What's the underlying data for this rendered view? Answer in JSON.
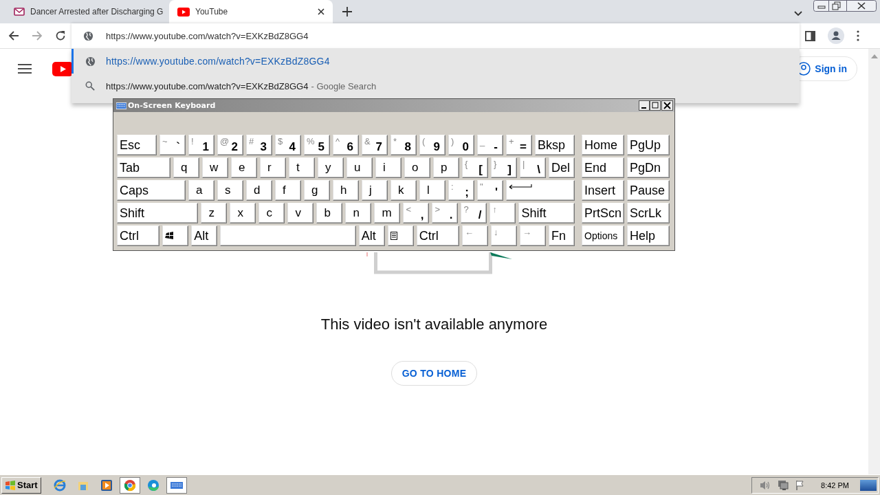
{
  "browser": {
    "tabs": [
      {
        "kind": "news",
        "title": "Dancer Arrested after Discharging G",
        "selected": false
      },
      {
        "kind": "youtube",
        "title": "YouTube",
        "selected": true
      }
    ],
    "omnibox": {
      "value": "https://www.youtube.com/watch?v=EXKzBdZ8GG4",
      "expanded": true
    },
    "suggestions": [
      {
        "kind": "url",
        "text": "https://www.youtube.com/watch?v=EXKzBdZ8GG4",
        "selected": true
      },
      {
        "kind": "search",
        "text": "https://www.youtube.com/watch?v=EXKzBdZ8GG4",
        "suffix": "- Google Search",
        "selected": false
      }
    ]
  },
  "page": {
    "sign_in": "Sign in",
    "message": "This video isn't available anymore",
    "home_button": "GO TO HOME"
  },
  "keyboard": {
    "title": "On-Screen Keyboard",
    "main_rows": [
      [
        {
          "kind": "wide",
          "label": "Esc"
        },
        {
          "kind": "key",
          "shift": "~",
          "label": "`"
        },
        {
          "kind": "key",
          "shift": "!",
          "label": "1"
        },
        {
          "kind": "key",
          "shift": "@",
          "label": "2"
        },
        {
          "kind": "key",
          "shift": "#",
          "label": "3"
        },
        {
          "kind": "key",
          "shift": "$",
          "label": "4"
        },
        {
          "kind": "key",
          "shift": "%",
          "label": "5"
        },
        {
          "kind": "key",
          "shift": "^",
          "label": "6"
        },
        {
          "kind": "key",
          "shift": "&",
          "label": "7"
        },
        {
          "kind": "key",
          "shift": "*",
          "label": "8"
        },
        {
          "kind": "key",
          "shift": "(",
          "label": "9"
        },
        {
          "kind": "key",
          "shift": ")",
          "label": "0"
        },
        {
          "kind": "key",
          "shift": "_",
          "label": "-"
        },
        {
          "kind": "key",
          "shift": "+",
          "label": "="
        },
        {
          "kind": "wide",
          "label": "Bksp"
        }
      ],
      [
        {
          "kind": "wide",
          "label": "Tab"
        },
        {
          "kind": "key",
          "label": "q"
        },
        {
          "kind": "key",
          "label": "w"
        },
        {
          "kind": "key",
          "label": "e"
        },
        {
          "kind": "key",
          "label": "r"
        },
        {
          "kind": "key",
          "label": "t"
        },
        {
          "kind": "key",
          "label": "y"
        },
        {
          "kind": "key",
          "label": "u"
        },
        {
          "kind": "key",
          "label": "i"
        },
        {
          "kind": "key",
          "label": "o"
        },
        {
          "kind": "key",
          "label": "p"
        },
        {
          "kind": "key",
          "shift": "{",
          "label": "["
        },
        {
          "kind": "key",
          "shift": "}",
          "label": "]"
        },
        {
          "kind": "key",
          "shift": "|",
          "label": "\\"
        },
        {
          "kind": "key",
          "label": "Del"
        }
      ],
      [
        {
          "kind": "wide",
          "label": "Caps"
        },
        {
          "kind": "key",
          "label": "a"
        },
        {
          "kind": "key",
          "label": "s"
        },
        {
          "kind": "key",
          "label": "d"
        },
        {
          "kind": "key",
          "label": "f"
        },
        {
          "kind": "key",
          "label": "g"
        },
        {
          "kind": "key",
          "label": "h"
        },
        {
          "kind": "key",
          "label": "j"
        },
        {
          "kind": "key",
          "label": "k"
        },
        {
          "kind": "key",
          "label": "l"
        },
        {
          "kind": "key",
          "shift": ":",
          "label": ";"
        },
        {
          "kind": "key",
          "shift": "\"",
          "label": "'"
        },
        {
          "kind": "enter"
        }
      ],
      [
        {
          "kind": "wider",
          "label": "Shift"
        },
        {
          "kind": "key",
          "label": "z"
        },
        {
          "kind": "key",
          "label": "x"
        },
        {
          "kind": "key",
          "label": "c"
        },
        {
          "kind": "key",
          "label": "v"
        },
        {
          "kind": "key",
          "label": "b"
        },
        {
          "kind": "key",
          "label": "n"
        },
        {
          "kind": "key",
          "label": "m"
        },
        {
          "kind": "key",
          "shift": "<",
          "label": ","
        },
        {
          "kind": "key",
          "shift": ">",
          "label": "."
        },
        {
          "kind": "key",
          "shift": "?",
          "label": "/"
        },
        {
          "kind": "key",
          "shift": "↑"
        },
        {
          "kind": "wide",
          "label": "Shift"
        }
      ],
      [
        {
          "kind": "wide",
          "label": "Ctrl"
        },
        {
          "kind": "winkey"
        },
        {
          "kind": "key",
          "label": "Alt"
        },
        {
          "kind": "space"
        },
        {
          "kind": "key",
          "label": "Alt"
        },
        {
          "kind": "menukey"
        },
        {
          "kind": "wide",
          "label": "Ctrl"
        },
        {
          "kind": "key",
          "shift": "←"
        },
        {
          "kind": "key",
          "shift": "↓"
        },
        {
          "kind": "key",
          "shift": "→"
        },
        {
          "kind": "key",
          "label": "Fn"
        }
      ]
    ],
    "nav_rows": [
      [
        {
          "kind": "key",
          "label": "Home"
        },
        {
          "kind": "key",
          "label": "PgUp"
        }
      ],
      [
        {
          "kind": "key",
          "label": "End"
        },
        {
          "kind": "key",
          "label": "PgDn"
        }
      ],
      [
        {
          "kind": "key",
          "label": "Insert"
        },
        {
          "kind": "key",
          "label": "Pause"
        }
      ],
      [
        {
          "kind": "key",
          "label": "PrtScn"
        },
        {
          "kind": "key",
          "label": "ScrLk"
        }
      ],
      [
        {
          "kind": "small",
          "label": "Options"
        },
        {
          "kind": "key",
          "label": "Help"
        }
      ]
    ]
  },
  "taskbar": {
    "start": "Start",
    "apps": [
      {
        "kind": "ie",
        "active": false
      },
      {
        "kind": "folder",
        "active": false
      },
      {
        "kind": "media",
        "active": false
      },
      {
        "kind": "chrome",
        "active": true
      },
      {
        "kind": "edge",
        "active": false
      },
      {
        "kind": "keyboard",
        "active": true
      }
    ],
    "clock": "8:42 PM"
  }
}
